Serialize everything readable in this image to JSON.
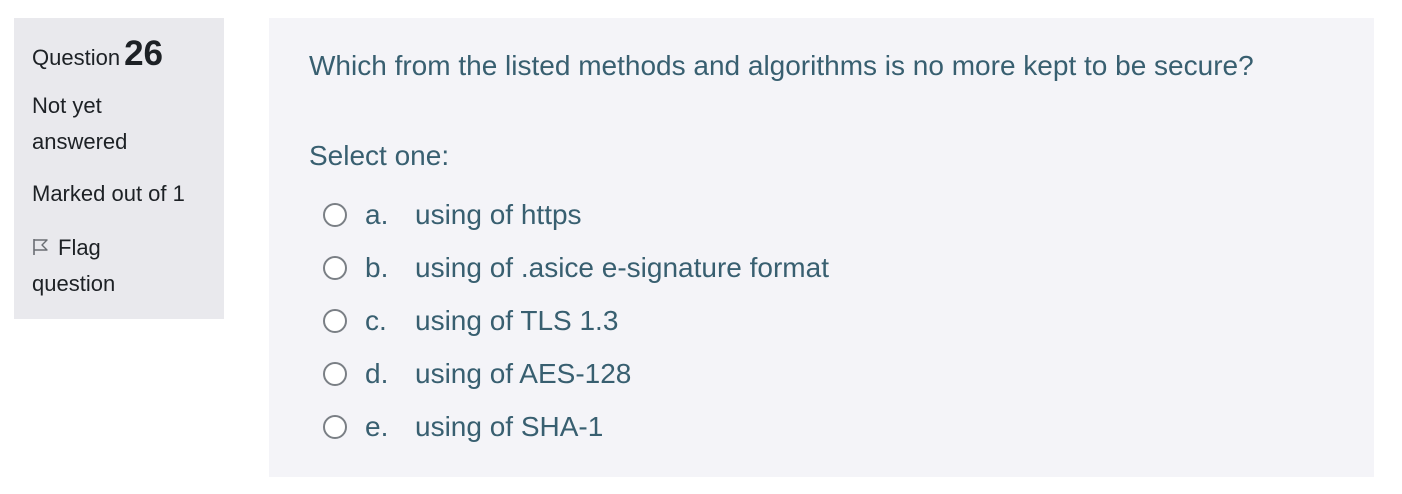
{
  "info": {
    "question_label": "Question",
    "question_number": "26",
    "state": "Not yet answered",
    "grade": "Marked out of 1",
    "flag_label": "Flag question"
  },
  "question": {
    "text": "Which from the listed methods and algorithms is no more kept to be secure?",
    "prompt": "Select one:",
    "answers": [
      {
        "letter": "a.",
        "text": "using of https"
      },
      {
        "letter": "b.",
        "text": "using of .asice e-signature format"
      },
      {
        "letter": "c.",
        "text": "using of TLS 1.3"
      },
      {
        "letter": "d.",
        "text": "using of AES-128"
      },
      {
        "letter": "e.",
        "text": "using of SHA-1"
      }
    ]
  },
  "icons": {
    "flag": "flag-icon",
    "radio": "radio-unchecked-icon"
  },
  "colors": {
    "info_background": "#e9e9ed",
    "content_background": "#f4f4f8",
    "question_text": "#385f70"
  }
}
